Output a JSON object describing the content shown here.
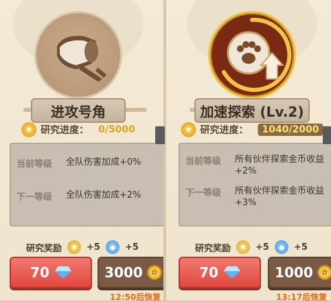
{
  "cards": [
    {
      "title": "进攻号角",
      "icon": "horn-icon",
      "progress_label": "研究进度：",
      "progress_value": "0/5000",
      "current_label": "当前等级",
      "current_value": "全队伤害加成+0%",
      "next_label": "下一等级",
      "next_value": "全队伤害加成+2%",
      "reward_label": "研究奖励",
      "reward_star": "+5",
      "reward_gem": "+5",
      "gem_cost": "70",
      "coin_cost": "3000",
      "timer": "12:50后恢复"
    },
    {
      "title": "加速探索 (Lv.2)",
      "icon": "paw-speed-icon",
      "progress_label": "研究进度：",
      "progress_value": "1040/2000",
      "current_label": "当前等级",
      "current_value": "所有伙伴探索金币收益+2%",
      "next_label": "下一等级",
      "next_value": "所有伙伴探索金币收益+3%",
      "reward_label": "研究奖励",
      "reward_star": "+5",
      "reward_gem": "+5",
      "gem_cost": "70",
      "coin_cost": "1000",
      "timer": "13:17后恢复"
    }
  ],
  "colors": {
    "gem_button": "#e0483e",
    "coin_button": "#7a5a44",
    "progress_value": "#e0a21a",
    "timer": "#e86a1a"
  }
}
